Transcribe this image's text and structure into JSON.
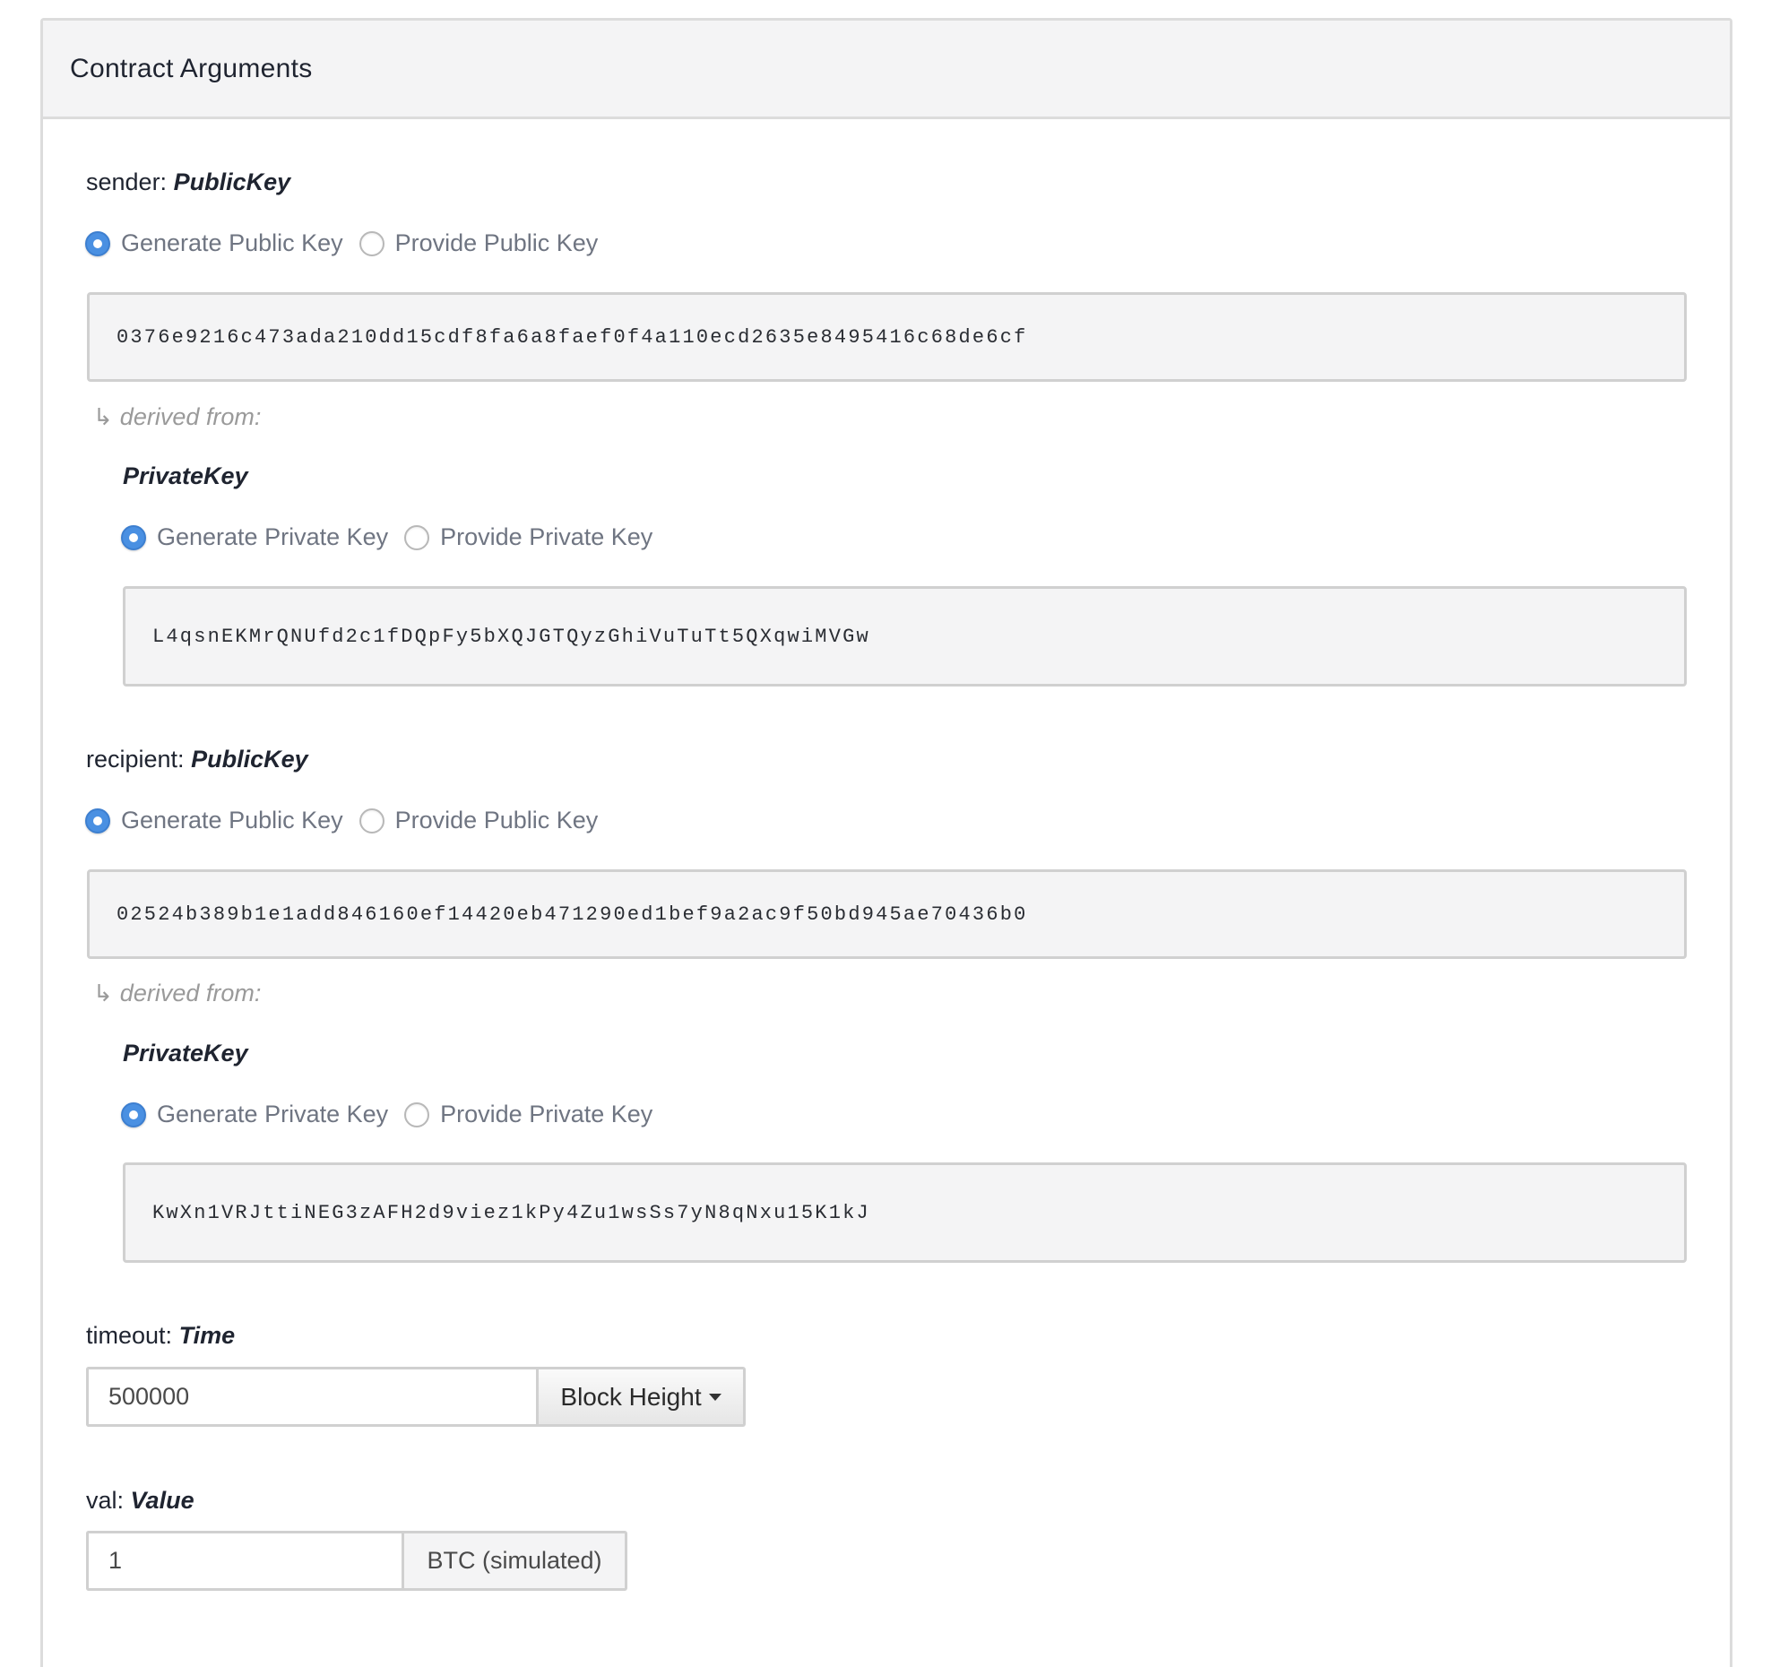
{
  "panel": {
    "title": "Contract Arguments"
  },
  "sender": {
    "name": "sender:",
    "type": "PublicKey",
    "options": [
      {
        "label": "Generate Public Key",
        "selected": true
      },
      {
        "label": "Provide Public Key",
        "selected": false
      }
    ],
    "public_key": "0376e9216c473ada210dd15cdf8fa6a8faef0f4a110ecd2635e8495416c68de6cf",
    "derived_label": "derived from:",
    "derived_arrow": "↳",
    "private": {
      "type": "PrivateKey",
      "options": [
        {
          "label": "Generate Private Key",
          "selected": true
        },
        {
          "label": "Provide Private Key",
          "selected": false
        }
      ],
      "private_key": "L4qsnEKMrQNUfd2c1fDQpFy5bXQJGTQyzGhiVuTuTt5QXqwiMVGw"
    }
  },
  "recipient": {
    "name": "recipient:",
    "type": "PublicKey",
    "options": [
      {
        "label": "Generate Public Key",
        "selected": true
      },
      {
        "label": "Provide Public Key",
        "selected": false
      }
    ],
    "public_key": "02524b389b1e1add846160ef14420eb471290ed1bef9a2ac9f50bd945ae70436b0",
    "derived_label": "derived from:",
    "derived_arrow": "↳",
    "private": {
      "type": "PrivateKey",
      "options": [
        {
          "label": "Generate Private Key",
          "selected": true
        },
        {
          "label": "Provide Private Key",
          "selected": false
        }
      ],
      "private_key": "KwXn1VRJttiNEG3zAFH2d9viez1kPy4Zu1wsSs7yN8qNxu15K1kJ"
    }
  },
  "timeout": {
    "name": "timeout:",
    "type": "Time",
    "value": "500000",
    "unit_dropdown": "Block Height"
  },
  "val": {
    "name": "val:",
    "type": "Value",
    "value": "1",
    "unit": "BTC (simulated)"
  },
  "colors": {
    "accent": "#4a90e2",
    "header_bg": "#f4f4f5",
    "border": "#d0d0d0"
  }
}
